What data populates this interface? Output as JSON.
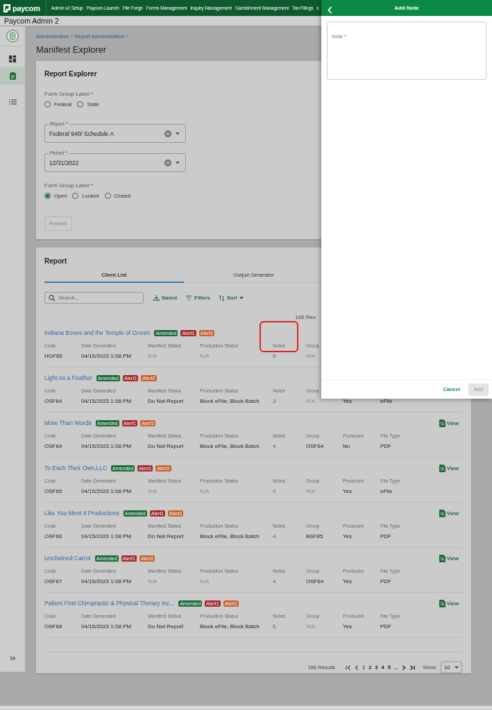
{
  "top_nav": {
    "logo": "paycom",
    "items": [
      "Admin v2 Setup",
      "Paycom Launch",
      "File Forge",
      "Forms Management",
      "Inquiry Management",
      "Garnishment Management",
      "Tax Filings",
      "s"
    ]
  },
  "app_title": "Paycom Admin 2",
  "sidebar": {
    "items": [
      {
        "kind": "dashboard",
        "selected": false
      },
      {
        "kind": "clipboard",
        "selected": true
      },
      {
        "kind": "list",
        "selected": false
      }
    ]
  },
  "breadcrumb": {
    "items": [
      "Administration",
      "Report Administration"
    ],
    "separator": "/"
  },
  "page_title": "Manifest Explorer",
  "report_explorer": {
    "title": "Report Explorer",
    "controls": [
      {
        "kind": "radio_group",
        "label": "Form Group Label",
        "required_mark": "*",
        "options": [
          {
            "label": "Federal",
            "selected": false
          },
          {
            "label": "State",
            "selected": false
          }
        ]
      },
      {
        "kind": "select",
        "label": "Report",
        "required_mark": "*",
        "value": "Federal 940/ Schedule A"
      },
      {
        "kind": "select",
        "label": "Period",
        "required_mark": "*",
        "value": "12/31/2022"
      },
      {
        "kind": "radio_group",
        "label": "Form Group Label",
        "required_mark": "*",
        "options": [
          {
            "label": "Open",
            "selected": true
          },
          {
            "label": "Locked",
            "selected": false
          },
          {
            "label": "Closed",
            "selected": false
          }
        ]
      }
    ],
    "refresh_button": {
      "label": "Refresh",
      "disabled": true
    }
  },
  "report": {
    "title": "Report",
    "tabs": [
      {
        "label": "Client List",
        "selected": true
      },
      {
        "label": "Output Generator",
        "selected": false
      }
    ],
    "search": {
      "placeholder": "Search..."
    },
    "actions": [
      {
        "kind": "saved",
        "label": "Saved"
      },
      {
        "kind": "filters",
        "label": "Filters"
      },
      {
        "kind": "sort",
        "label": "Sort"
      }
    ],
    "results_top": "166 Res",
    "rows": [
      {
        "title": "Indiana Bones and the Temple of Groom",
        "tags": [
          {
            "label": "Amended",
            "color": "#1d6b3a"
          },
          {
            "label": "Alert1",
            "color": "#a52a2a"
          },
          {
            "label": "Alert2",
            "color": "#c8652e"
          }
        ],
        "fields": [
          {
            "label": "Code",
            "value": "HGF65",
            "kind": "text"
          },
          {
            "label": "Date Generated",
            "value": "04/15/2023 1:08 PM",
            "kind": "text"
          },
          {
            "label": "Manifest Status",
            "value": "N/A",
            "kind": "muted"
          },
          {
            "label": "Production Status",
            "value": "N/A",
            "kind": "muted"
          },
          {
            "label": "Notes",
            "value": "8",
            "kind": "link",
            "highlighted": true
          },
          {
            "label": "Group",
            "value": "N/A",
            "kind": "muted"
          }
        ]
      },
      {
        "title": "Light As a Feather",
        "tags": [
          {
            "label": "Amended",
            "color": "#1d6b3a"
          },
          {
            "label": "Alert1",
            "color": "#a52a2a"
          },
          {
            "label": "Alert2",
            "color": "#c8652e"
          }
        ],
        "fields": [
          {
            "label": "Code",
            "value": "OSF64",
            "kind": "text"
          },
          {
            "label": "Date Generated",
            "value": "04/15/2023 1:08 PM",
            "kind": "text"
          },
          {
            "label": "Manifest Status",
            "value": "Do Not Report",
            "kind": "text"
          },
          {
            "label": "Production Status",
            "value": "Block eFile, Block Batch",
            "kind": "text"
          },
          {
            "label": "Notes",
            "value": "3",
            "kind": "link",
            "highlighted": false
          },
          {
            "label": "Group",
            "value": "N/A",
            "kind": "muted"
          },
          {
            "value": "Yes",
            "kind": "text"
          },
          {
            "value": "eFile",
            "kind": "text"
          }
        ]
      },
      {
        "title": "More Than Words",
        "tags": [
          {
            "label": "Amended",
            "color": "#1d6b3a"
          },
          {
            "label": "Alert1",
            "color": "#a52a2a"
          },
          {
            "label": "Alert2",
            "color": "#c8652e"
          }
        ],
        "view": "View",
        "fields": [
          {
            "label": "Code",
            "value": "OSF64",
            "kind": "text"
          },
          {
            "label": "Date Generated",
            "value": "04/15/2023 1:08 PM",
            "kind": "text"
          },
          {
            "label": "Manifest Status",
            "value": "Do Not Report",
            "kind": "text"
          },
          {
            "label": "Production Status",
            "value": "Block eFile, Block Batch",
            "kind": "text"
          },
          {
            "label": "Notes",
            "value": "4",
            "kind": "link",
            "highlighted": false
          },
          {
            "label": "Group",
            "value": "OSF64",
            "kind": "text"
          },
          {
            "label": "Produced",
            "value": "No",
            "kind": "text"
          },
          {
            "label": "File Type",
            "value": "PDF",
            "kind": "text"
          }
        ]
      },
      {
        "title": "To Each Their Own,LLC",
        "tags": [
          {
            "label": "Amended",
            "color": "#1d6b3a"
          },
          {
            "label": "Alert1",
            "color": "#a52a2a"
          },
          {
            "label": "Alert2",
            "color": "#c8652e"
          }
        ],
        "view": "View",
        "fields": [
          {
            "label": "Code",
            "value": "OSF65",
            "kind": "text"
          },
          {
            "label": "Date Generated",
            "value": "04/15/2023 1:08 PM",
            "kind": "text"
          },
          {
            "label": "Manifest Status",
            "value": "N/A",
            "kind": "muted"
          },
          {
            "label": "Production Status",
            "value": "N/A",
            "kind": "muted"
          },
          {
            "label": "Notes",
            "value": "0",
            "kind": "link",
            "highlighted": false
          },
          {
            "label": "Group",
            "value": "N/A",
            "kind": "muted"
          },
          {
            "label": "Produced",
            "value": "Yes",
            "kind": "text"
          },
          {
            "label": "File Type",
            "value": "eFile",
            "kind": "text"
          }
        ]
      },
      {
        "title": "Like You Ment It Productions",
        "tags": [
          {
            "label": "Amended",
            "color": "#1d6b3a"
          },
          {
            "label": "Alert1",
            "color": "#a52a2a"
          },
          {
            "label": "Alert2",
            "color": "#c8652e"
          }
        ],
        "view": "View",
        "fields": [
          {
            "label": "Code",
            "value": "OSF66",
            "kind": "text"
          },
          {
            "label": "Date Generated",
            "value": "04/15/2023 1:08 PM",
            "kind": "text"
          },
          {
            "label": "Manifest Status",
            "value": "Do Not Report",
            "kind": "text"
          },
          {
            "label": "Production Status",
            "value": "Block eFile, Block Batch",
            "kind": "text"
          },
          {
            "label": "Notes",
            "value": "4",
            "kind": "link",
            "highlighted": false
          },
          {
            "label": "Group",
            "value": "BSF85",
            "kind": "text"
          },
          {
            "label": "Produced",
            "value": "Yes",
            "kind": "text"
          },
          {
            "label": "File Type",
            "value": "PDF",
            "kind": "text"
          }
        ]
      },
      {
        "title": "Unchained Carrot",
        "tags": [
          {
            "label": "Amended",
            "color": "#1d6b3a"
          },
          {
            "label": "Alert1",
            "color": "#a52a2a"
          },
          {
            "label": "Alert2",
            "color": "#c8652e"
          }
        ],
        "view": "View",
        "fields": [
          {
            "label": "Code",
            "value": "OSF67",
            "kind": "text"
          },
          {
            "label": "Date Generated",
            "value": "04/15/2023 1:08 PM",
            "kind": "text"
          },
          {
            "label": "Manifest Status",
            "value": "N/A",
            "kind": "muted"
          },
          {
            "label": "Production Status",
            "value": "N/A",
            "kind": "muted"
          },
          {
            "label": "Notes",
            "value": "4",
            "kind": "link",
            "highlighted": false
          },
          {
            "label": "Group",
            "value": "OSF64",
            "kind": "text"
          },
          {
            "label": "Produced",
            "value": "Yes",
            "kind": "text"
          },
          {
            "label": "File Type",
            "value": "PDF",
            "kind": "text"
          }
        ]
      },
      {
        "title": "Patient First Chiropractic & Physical Therary Inc...",
        "tags": [
          {
            "label": "Amended",
            "color": "#1d6b3a"
          },
          {
            "label": "Alert1",
            "color": "#a52a2a"
          },
          {
            "label": "Alert2",
            "color": "#c8652e"
          }
        ],
        "view": "View",
        "fields": [
          {
            "label": "Code",
            "value": "OSF68",
            "kind": "text"
          },
          {
            "label": "Date Generated",
            "value": "04/15/2023 1:08 PM",
            "kind": "text"
          },
          {
            "label": "Manifest Status",
            "value": "Do Not Report",
            "kind": "text"
          },
          {
            "label": "Production Status",
            "value": "Block eFile, Block Batch",
            "kind": "text"
          },
          {
            "label": "Notes",
            "value": "5",
            "kind": "link",
            "highlighted": false
          },
          {
            "label": "Group",
            "value": "N/A",
            "kind": "muted"
          },
          {
            "label": "Produced",
            "value": "Yes",
            "kind": "text"
          },
          {
            "label": "File Type",
            "value": "PDF",
            "kind": "text"
          }
        ]
      }
    ],
    "pagination": {
      "results": "166 Results",
      "pages": [
        {
          "label": "1",
          "selected": true
        },
        {
          "label": "2",
          "selected": false
        },
        {
          "label": "3",
          "selected": false
        },
        {
          "label": "4",
          "selected": false
        },
        {
          "label": "5",
          "selected": false
        },
        {
          "label": "...",
          "selected": false
        }
      ],
      "show_label": "Show:",
      "show_value": "10"
    }
  },
  "drawer": {
    "title": "Add Note",
    "note_field": {
      "label": "Note",
      "required_mark": "*"
    },
    "cancel": "Cancel",
    "add_button": {
      "label": "Add",
      "disabled": true
    }
  }
}
